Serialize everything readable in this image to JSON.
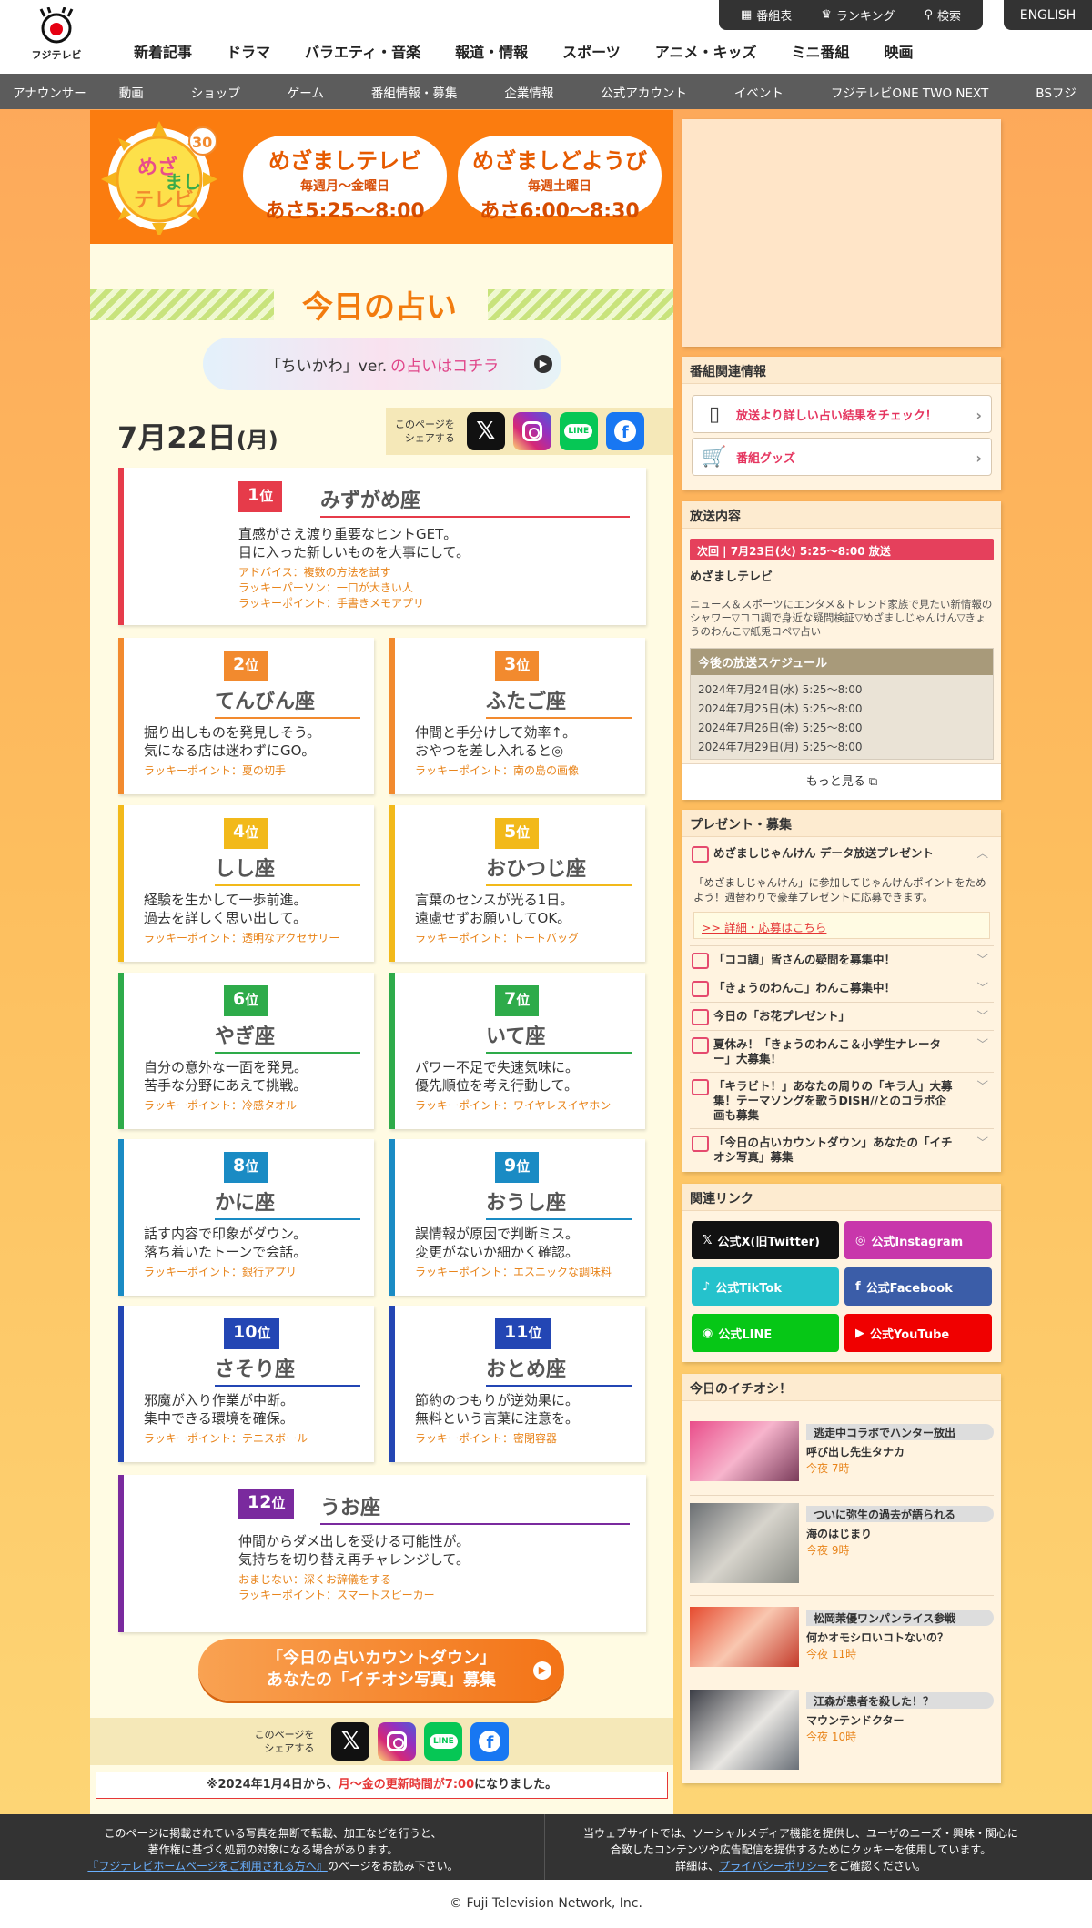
{
  "header": {
    "logo_text": "フジテレビ",
    "util": [
      "番組表",
      "ランキング",
      "検索"
    ],
    "english": "ENGLISH",
    "nav": [
      "新着記事",
      "ドラマ",
      "バラエティ・音楽",
      "報道・情報",
      "スポーツ",
      "アニメ・キッズ",
      "ミニ番組",
      "映画"
    ],
    "subnav": [
      "アナウンサー",
      "動画",
      "ショップ",
      "ゲーム",
      "番組情報・募集",
      "企業情報",
      "公式アカウント",
      "イベント",
      "フジテレビONE TWO NEXT",
      "BSフジ"
    ]
  },
  "banner": {
    "logo_alt": "めざましテレビ",
    "logo_anniv": "30",
    "weekday": {
      "title": "めざましテレビ",
      "days": "毎週月〜金曜日",
      "hours": "あさ5:25〜8:00"
    },
    "saturday": {
      "title": "めざましどようび",
      "days": "毎週土曜日",
      "hours": "あさ6:00〜8:30"
    }
  },
  "uranai": {
    "title": "今日の占い",
    "chiikawa": {
      "prefix": "「ちいかわ」ver.",
      "link": "の占いはコチラ"
    },
    "date": {
      "md": "7月22日",
      "dow": "(月)"
    },
    "share_label_1": "このページを",
    "share_label_2": "シェアする",
    "ranks": [
      {
        "rank": "1",
        "sign": "みずがめ座",
        "color": "#e63b4a",
        "desc1": "直感がさえ渡り重要なヒントGET。",
        "desc2": "目に入った新しいものを大事にして。",
        "advice": "アドバイス：複数の方法を試す",
        "person": "ラッキーパーソン：一口が大きい人",
        "point": "ラッキーポイント：手書きメモアプリ"
      },
      {
        "rank": "2",
        "sign": "てんびん座",
        "color": "#f28a2e",
        "desc1": "掘り出しものを発見しそう。",
        "desc2": "気になる店は迷わずにGO。",
        "point": "ラッキーポイント：夏の切手"
      },
      {
        "rank": "3",
        "sign": "ふたご座",
        "color": "#f28a2e",
        "desc1": "仲間と手分けして効率↑。",
        "desc2": "おやつを差し入れると◎",
        "point": "ラッキーポイント：南の島の画像"
      },
      {
        "rank": "4",
        "sign": "しし座",
        "color": "#f2b91a",
        "desc1": "経験を生かして一歩前進。",
        "desc2": "過去を詳しく思い出して。",
        "point": "ラッキーポイント：透明なアクセサリー"
      },
      {
        "rank": "5",
        "sign": "おひつじ座",
        "color": "#f2b91a",
        "desc1": "言葉のセンスが光る1日。",
        "desc2": "遠慮せずお願いしてOK。",
        "point": "ラッキーポイント：トートバッグ"
      },
      {
        "rank": "6",
        "sign": "やぎ座",
        "color": "#2eab4a",
        "desc1": "自分の意外な一面を発見。",
        "desc2": "苦手な分野にあえて挑戦。",
        "point": "ラッキーポイント：冷感タオル"
      },
      {
        "rank": "7",
        "sign": "いて座",
        "color": "#2eab4a",
        "desc1": "パワー不足で失速気味に。",
        "desc2": "優先順位を考え行動して。",
        "point": "ラッキーポイント：ワイヤレスイヤホン"
      },
      {
        "rank": "8",
        "sign": "かに座",
        "color": "#1a8bc4",
        "desc1": "話す内容で印象がダウン。",
        "desc2": "落ち着いたトーンで会話。",
        "point": "ラッキーポイント：銀行アプリ"
      },
      {
        "rank": "9",
        "sign": "おうし座",
        "color": "#1a8bc4",
        "desc1": "誤情報が原因で判断ミス。",
        "desc2": "変更がないか細かく確認。",
        "point": "ラッキーポイント：エスニックな調味料"
      },
      {
        "rank": "10",
        "sign": "さそり座",
        "color": "#2346b4",
        "desc1": "邪魔が入り作業が中断。",
        "desc2": "集中できる環境を確保。",
        "point": "ラッキーポイント：テニスボール"
      },
      {
        "rank": "11",
        "sign": "おとめ座",
        "color": "#2346b4",
        "desc1": "節約のつもりが逆効果に。",
        "desc2": "無料という言葉に注意を。",
        "point": "ラッキーポイント：密閉容器"
      },
      {
        "rank": "12",
        "sign": "うお座",
        "color": "#7a2a9e",
        "desc1": "仲間からダメ出しを受ける可能性が。",
        "desc2": "気持ちを切り替え再チャレンジして。",
        "advice": "おまじない：深くお辞儀をする",
        "point": "ラッキーポイント：スマートスピーカー"
      }
    ],
    "rank_suffix": "位",
    "countdown": {
      "line1": "「今日の占いカウントダウン」",
      "line2": "あなたの「イチオシ写真」募集"
    },
    "notice": {
      "pre": "※2024年1月4日から、",
      "hl1": "月〜金の更新時間が7:00",
      "post": "になりました。"
    }
  },
  "sidebar": {
    "related": {
      "title": "番組関連情報",
      "link1": "放送より詳しい占い結果をチェック！",
      "link2": "番組グッズ"
    },
    "broadcast": {
      "title": "放送内容",
      "next": "次回 | 7月23日(火) 5:25〜8:00 放送",
      "program": "めざましテレビ",
      "desc": "ニュース＆スポーツにエンタメ＆トレンド家族で見たい新情報のシャワー▽ココ調で身近な疑問検証▽めざましじゃんけん▽きょうのわんこ▽紙兎ロペ▽占い",
      "sched_title": "今後の放送スケジュール",
      "schedule": [
        "2024年7月24日(水) 5:25〜8:00",
        "2024年7月25日(木) 5:25〜8:00",
        "2024年7月26日(金) 5:25〜8:00",
        "2024年7月29日(月) 5:25〜8:00"
      ],
      "more": "もっと見る"
    },
    "present": {
      "title": "プレゼント・募集",
      "open_title": "めざましじゃんけん データ放送プレゼント",
      "open_desc": "「めざましじゃんけん」に参加してじゃんけんポイントをためよう！週替わりで豪華プレゼントに応募できます。",
      "open_link": ">> 詳細・応募はこちら",
      "items": [
        "「ココ調」皆さんの疑問を募集中！",
        "「きょうのわんこ」わんこ募集中！",
        "今日の「お花プレゼント」",
        "夏休み！「きょうのわんこ＆小学生ナレーター」大募集！",
        "「キラビト！」あなたの周りの「キラ人」大募集！テーマソングを歌うDISH//とのコラボ企画も募集",
        "「今日の占いカウントダウン」あなたの「イチオシ写真」募集"
      ]
    },
    "links": {
      "title": "関連リンク",
      "items": [
        {
          "label": "公式X(旧Twitter)",
          "color": "#111111"
        },
        {
          "label": "公式Instagram",
          "color": "#c837ab"
        },
        {
          "label": "公式TikTok",
          "color": "#25c2cc"
        },
        {
          "label": "公式Facebook",
          "color": "#3b5da8"
        },
        {
          "label": "公式LINE",
          "color": "#06c716"
        },
        {
          "label": "公式YouTube",
          "color": "#f00000"
        }
      ]
    },
    "pickup": {
      "title": "今日のイチオシ！",
      "items": [
        {
          "tag": "逃走中コラボでハンター放出",
          "name": "呼び出し先生タナカ",
          "time": "今夜 7時"
        },
        {
          "tag": "ついに弥生の過去が語られる",
          "name": "海のはじまり",
          "time": "今夜 9時"
        },
        {
          "tag": "松岡茉優ワンパンライス参戦",
          "name": "何かオモシロいコトないの？",
          "time": "今夜 11時"
        },
        {
          "tag": "江森が患者を殺した！？",
          "name": "マウンテンドクター",
          "time": "今夜 10時"
        }
      ]
    }
  },
  "footer": {
    "left1": "このページに掲載されている写真を無断で転載、加工などを行うと、",
    "left2": "著作権に基づく処罰の対象になる場合があります。",
    "left3_link": "『フジテレビホームページをご利用される方へ』",
    "left3_post": "のページをお読み下さい。",
    "right1": "当ウェブサイトでは、ソーシャルメディア機能を提供し、ユーザのニーズ・興味・関心に",
    "right2": "合致したコンテンツや広告配信を提供するためにクッキーを使用しています。",
    "right3_pre": "詳細は、",
    "right3_link": "プライバシーポリシー",
    "right3_post": "をご確認ください。",
    "copyright": "© Fuji Television Network, Inc."
  }
}
